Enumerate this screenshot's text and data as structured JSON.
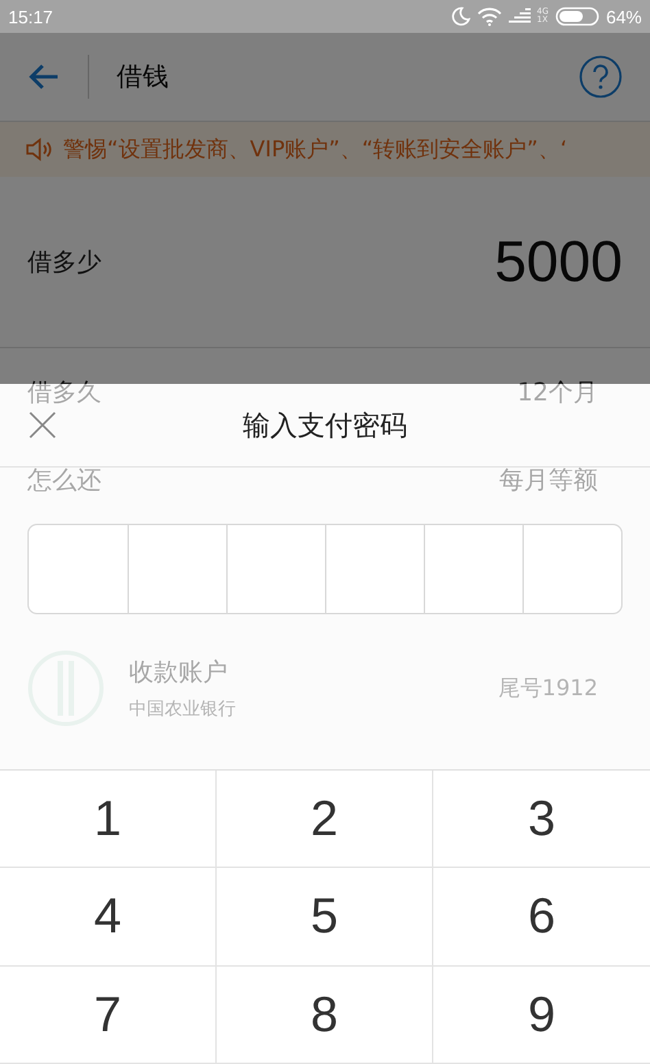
{
  "status_bar": {
    "time": "15:17",
    "network": "4G",
    "network_sub": "1X",
    "battery": "64%"
  },
  "header": {
    "title": "借钱"
  },
  "notice": {
    "text": "警惕“设置批发商、VIP账户”、“转账到安全账户”、‘"
  },
  "amount_row": {
    "label": "借多少",
    "value": "5000"
  },
  "rows": [
    {
      "label": "借多久",
      "value": "12个月"
    },
    {
      "label": "怎么还",
      "value": "每月等额"
    }
  ],
  "account": {
    "label": "收款账户",
    "bank": "中国农业银行",
    "tail": "尾号1912"
  },
  "sheet": {
    "title": "输入支付密码"
  },
  "keypad": [
    "1",
    "2",
    "3",
    "4",
    "5",
    "6",
    "7",
    "8",
    "9"
  ]
}
